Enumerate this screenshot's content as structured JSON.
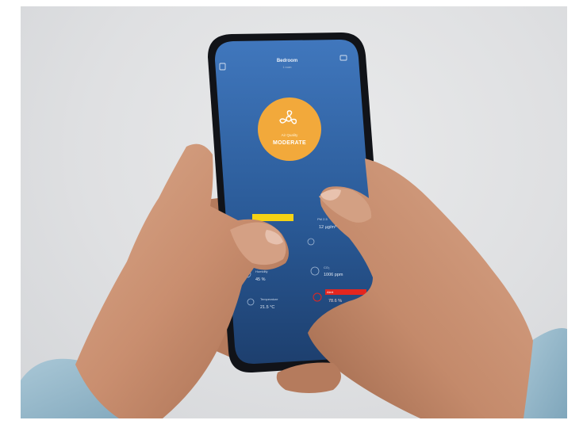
{
  "app": {
    "title": "Bedroom",
    "subtitle": "1 room"
  },
  "air_quality": {
    "label": "Air Quality",
    "status": "MODERATE",
    "accent_color": "#f2a93b"
  },
  "metrics": [
    {
      "icon": "humidity-icon",
      "label": "Humidity",
      "value": "45 %"
    },
    {
      "icon": "pm-icon",
      "label": "PM 2.5",
      "value": "12 µg/m³"
    },
    {
      "icon": "temperature-icon",
      "label": "Temperature",
      "value": "21.5 °C"
    },
    {
      "icon": "co2-icon",
      "label": "CO₂",
      "value": "1006 ppm"
    },
    {
      "icon": "alert-icon",
      "label": "Alert",
      "value": "78.6 %"
    }
  ],
  "colors": {
    "screen_top": "#3f78c0",
    "screen_bottom": "#1c3c6a",
    "yellow_bar": "#f5d315",
    "red_bar": "#e3261f"
  }
}
